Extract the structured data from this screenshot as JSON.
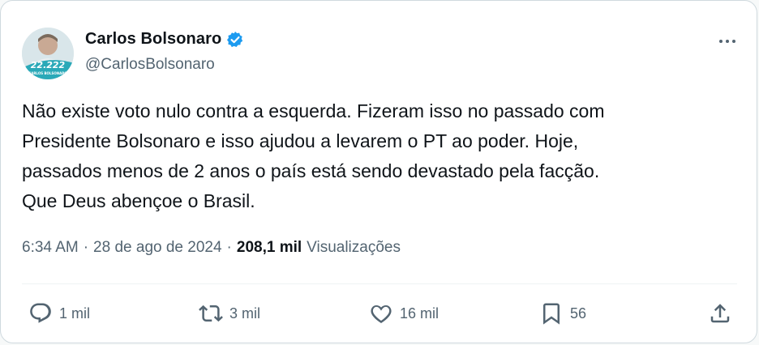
{
  "author": {
    "display_name": "Carlos Bolsonaro",
    "handle": "@CarlosBolsonaro",
    "avatar_text_top": "22.222",
    "avatar_text_bottom": "CARLOS BOLSONARO"
  },
  "tweet": {
    "text": "Não existe voto nulo contra a esquerda. Fizeram isso no passado com\nPresidente Bolsonaro e isso ajudou a levarem o PT ao poder. Hoje,\npassados menos de 2 anos o país está sendo devastado pela facção.\nQue Deus abençoe o Brasil."
  },
  "meta": {
    "time": "6:34 AM",
    "separator": "·",
    "date": "28 de ago de 2024",
    "views_count": "208,1 mil",
    "views_label": "Visualizações"
  },
  "actions": {
    "replies": "1 mil",
    "reposts": "3 mil",
    "likes": "16 mil",
    "bookmarks": "56"
  },
  "colors": {
    "text_primary": "#0f1419",
    "text_secondary": "#536471",
    "verified": "#1d9bf0",
    "border": "#cfd9de"
  },
  "icons": [
    "verified-badge-icon",
    "more-icon",
    "reply-icon",
    "repost-icon",
    "like-icon",
    "bookmark-icon",
    "share-icon"
  ]
}
